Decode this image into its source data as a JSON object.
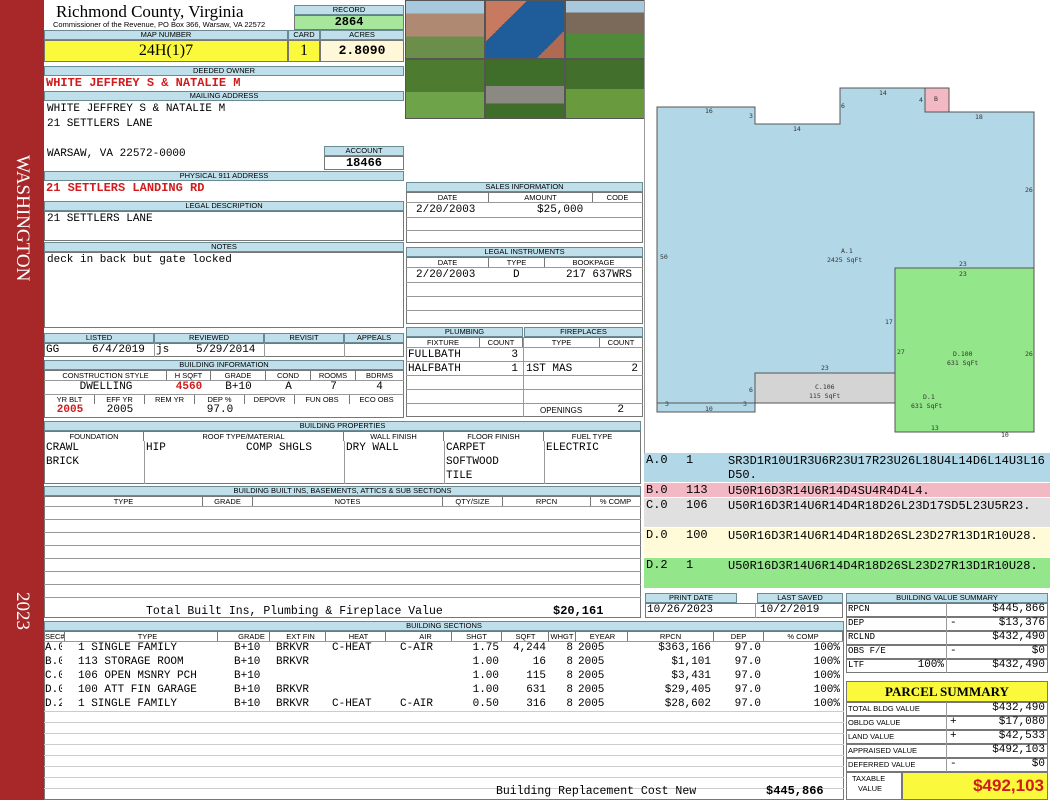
{
  "side": {
    "top": "WASHINGTON",
    "bottom": "2023"
  },
  "header": {
    "county": "Richmond County, Virginia",
    "commissioner": "Commissioner of the Revenue, PO Box 366, Warsaw, VA 22572",
    "record_label": "RECORD",
    "record": "2864",
    "map_label": "MAP NUMBER",
    "map": "24H(1)7",
    "card_label": "CARD",
    "card": "1",
    "acres_label": "ACRES",
    "acres": "2.8090"
  },
  "owner": {
    "label": "DEEDED OWNER",
    "name": "WHITE JEFFREY S & NATALIE M",
    "mail_label": "MAILING ADDRESS",
    "mail1": "WHITE JEFFREY S & NATALIE M",
    "mail2": "21 SETTLERS LANE",
    "mail3": "WARSAW, VA 22572-0000",
    "account_label": "ACCOUNT",
    "account": "18466"
  },
  "physical": {
    "label": "PHYSICAL 911 ADDRESS",
    "value": "21 SETTLERS LANDING RD"
  },
  "legal": {
    "label": "LEGAL DESCRIPTION",
    "value": "21 SETTLERS LANE"
  },
  "notes": {
    "label": "NOTES",
    "value": "deck in back but gate locked"
  },
  "sales": {
    "label": "SALES INFORMATION",
    "cols": [
      "DATE",
      "AMOUNT",
      "CODE"
    ],
    "date": "2/20/2003",
    "amount": "$25,000",
    "code": ""
  },
  "instr": {
    "label": "LEGAL INSTRUMENTS",
    "cols": [
      "DATE",
      "TYPE",
      "BOOKPAGE"
    ],
    "date": "2/20/2003",
    "type": "D",
    "book": "217 637WRS"
  },
  "listed": {
    "cols": [
      "LISTED",
      "REVIEWED",
      "REVISIT",
      "APPEALS"
    ],
    "l_by": "GG",
    "l_date": "6/4/2019",
    "r_by": "js",
    "r_date": "5/29/2014"
  },
  "plumb": {
    "label": "PLUMBING",
    "fix": "FIXTURE",
    "count": "COUNT",
    "r1": "FULLBATH",
    "c1": "3",
    "r2": "HALFBATH",
    "c2": "1"
  },
  "fire": {
    "label": "FIREPLACES",
    "type": "TYPE",
    "count": "COUNT",
    "r1": "1ST MAS",
    "c1": "2",
    "open": "OPENINGS",
    "openv": "2"
  },
  "bldg": {
    "label": "BUILDING INFORMATION",
    "cols": [
      "CONSTRUCTION STYLE",
      "H SQFT",
      "GRADE",
      "COND",
      "ROOMS",
      "BDRMS"
    ],
    "style": "DWELLING",
    "hsqft": "4560",
    "grade": "B+10",
    "cond": "A",
    "rooms": "7",
    "bdrms": "4",
    "cols2": [
      "YR BLT",
      "EFF YR",
      "REM YR",
      "DEP %",
      "DEPOVR",
      "FUN OBS",
      "ECO OBS"
    ],
    "yr": "2005",
    "eff": "2005",
    "rem": "",
    "dep": "97.0"
  },
  "props": {
    "label": "BUILDING PROPERTIES",
    "cols": [
      "FOUNDATION",
      "ROOF TYPE/MATERIAL",
      "WALL FINISH",
      "FLOOR FINISH",
      "FUEL TYPE"
    ],
    "f1": "CRAWL",
    "f2": "BRICK",
    "roof1": "HIP",
    "roof2": "COMP SHGLS",
    "wall": "DRY WALL",
    "fl1": "CARPET",
    "fl2": "SOFTWOOD",
    "fl3": "TILE",
    "fuel": "ELECTRIC"
  },
  "builtins": {
    "label": "BUILDING BUILT INS, BASEMENTS, ATTICS & SUB SECTIONS",
    "cols": [
      "TYPE",
      "GRADE",
      "NOTES",
      "QTY/SIZE",
      "RPCN",
      "% COMP"
    ],
    "total_label": "Total Built Ins, Plumbing & Fireplace Value",
    "total": "$20,161"
  },
  "sections": {
    "label": "BUILDING SECTIONS",
    "cols": [
      "SEC#",
      "TYPE",
      "GRADE",
      "EXT FIN",
      "HEAT",
      "AIR",
      "SHGT",
      "SQFT",
      "WHGT",
      "EYEAR",
      "RPCN",
      "DEP",
      "% COMP"
    ],
    "rows": [
      [
        "A.0",
        "1 SINGLE FAMILY",
        "B+10",
        "BRKVR",
        "C-HEAT",
        "C-AIR",
        "1.75",
        "4,244",
        "8",
        "2005",
        "$363,166",
        "97.0",
        "100%"
      ],
      [
        "B.0",
        "113 STORAGE ROOM",
        "B+10",
        "BRKVR",
        "",
        "",
        "1.00",
        "16",
        "8",
        "2005",
        "$1,101",
        "97.0",
        "100%"
      ],
      [
        "C.0",
        "106 OPEN MSNRY PCH",
        "B+10",
        "",
        "",
        "",
        "1.00",
        "115",
        "8",
        "2005",
        "$3,431",
        "97.0",
        "100%"
      ],
      [
        "D.0",
        "100 ATT FIN GARAGE",
        "B+10",
        "BRKVR",
        "",
        "",
        "1.00",
        "631",
        "8",
        "2005",
        "$29,405",
        "97.0",
        "100%"
      ],
      [
        "D.2",
        "1 SINGLE FAMILY",
        "B+10",
        "BRKVR",
        "C-HEAT",
        "C-AIR",
        "0.50",
        "316",
        "8",
        "2005",
        "$28,602",
        "97.0",
        "100%"
      ]
    ],
    "total_label": "Building Replacement Cost New",
    "total": "$445,866"
  },
  "sketch": {
    "a": "A.1",
    "a_sq": "2425 SqFt",
    "b": "B",
    "c": "C.106",
    "c_sq": "115 SqFt",
    "d": "D.100",
    "d_sq": "631 SqFt",
    "d1": "D.1",
    "d1_sq": "631 SqFt",
    "dims": [
      "16",
      "3",
      "6",
      "14",
      "4",
      "18",
      "14",
      "26",
      "50",
      "23",
      "23",
      "17",
      "27",
      "26",
      "23",
      "6",
      "3",
      "10",
      "3",
      "13",
      "10"
    ],
    "colors": {
      "a": "#b2d8e8",
      "b": "#f2b8c4",
      "c": "#d4d4d4",
      "d": "#94e68a"
    }
  },
  "codes": [
    {
      "sec": "A.0",
      "n": "1",
      "code": "SR3D1R10U1R3U6R23U17R23U26L18U4L14D6L14U3L16D50.",
      "bg": "#b2d8e8"
    },
    {
      "sec": "B.0",
      "n": "113",
      "code": "U50R16D3R14U6R14D4SU4R4D4L4.",
      "bg": "#f2b8c4"
    },
    {
      "sec": "C.0",
      "n": "106",
      "code": "U50R16D3R14U6R14D4R18D26L23D17SD5L23U5R23.",
      "bg": "#e0e0e0"
    },
    {
      "sec": "D.0",
      "n": "100",
      "code": "U50R16D3R14U6R14D4R18D26SL23D27R13D1R10U28.",
      "bg": "#fffbd8"
    },
    {
      "sec": "D.2",
      "n": "1",
      "code": "U50R16D3R14U6R14D4R18D26SL23D27R13D1R10U28.",
      "bg": "#94e68a"
    }
  ],
  "print": {
    "pd_label": "PRINT DATE",
    "pd": "10/26/2023",
    "ls_label": "LAST SAVED",
    "ls": "10/2/2019"
  },
  "bvs": {
    "label": "BUILDING VALUE SUMMARY",
    "rows": [
      [
        "RPCN",
        "",
        "",
        "$445,866"
      ],
      [
        "DEP",
        "",
        "-",
        "$13,376"
      ],
      [
        "RCLND",
        "",
        "",
        "$432,490"
      ],
      [
        "OBS F/E",
        "",
        "-",
        "$0"
      ],
      [
        "LTF",
        "100%",
        "",
        "$432,490"
      ]
    ]
  },
  "ps": {
    "label": "PARCEL SUMMARY",
    "rows": [
      [
        "TOTAL BLDG VALUE",
        "",
        "$432,490"
      ],
      [
        "OBLDG VALUE",
        "+",
        "$17,080"
      ],
      [
        "LAND VALUE",
        "+",
        "$42,533"
      ],
      [
        "APPRAISED VALUE",
        "",
        "$492,103"
      ],
      [
        "DEFERRED VALUE",
        "-",
        "$0"
      ]
    ],
    "tax_label1": "TAXABLE",
    "tax_label2": "VALUE",
    "tax": "$492,103"
  }
}
